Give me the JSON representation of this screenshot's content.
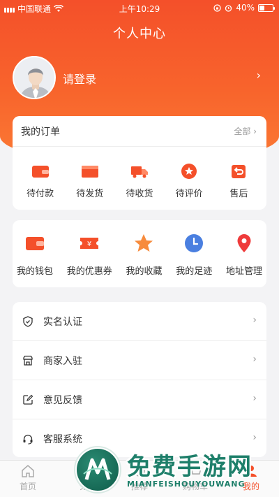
{
  "status_bar": {
    "carrier": "中国联通",
    "time": "上午10:29",
    "battery": "40%"
  },
  "header": {
    "title": "个人中心",
    "login_text": "请登录"
  },
  "orders": {
    "title": "我的订单",
    "all_label": "全部",
    "items": [
      {
        "label": "待付款",
        "icon": "wallet-icon"
      },
      {
        "label": "待发货",
        "icon": "package-icon"
      },
      {
        "label": "待收货",
        "icon": "truck-icon"
      },
      {
        "label": "待评价",
        "icon": "star-badge-icon"
      },
      {
        "label": "售后",
        "icon": "return-icon"
      }
    ]
  },
  "tools": [
    {
      "label": "我的钱包",
      "icon": "wallet-icon"
    },
    {
      "label": "我的优惠券",
      "icon": "coupon-icon"
    },
    {
      "label": "我的收藏",
      "icon": "star-icon"
    },
    {
      "label": "我的足迹",
      "icon": "clock-icon"
    },
    {
      "label": "地址管理",
      "icon": "location-pin-icon"
    }
  ],
  "menu": [
    {
      "label": "实名认证",
      "icon": "shield-check-icon"
    },
    {
      "label": "商家入驻",
      "icon": "store-icon"
    },
    {
      "label": "意见反馈",
      "icon": "edit-icon"
    },
    {
      "label": "客服系统",
      "icon": "headset-icon"
    }
  ],
  "tabbar": {
    "items": [
      {
        "label": "首页",
        "icon": "home-icon"
      },
      {
        "label": "分",
        "icon": "category-icon"
      },
      {
        "label": "推荐",
        "icon": "recommend-icon"
      },
      {
        "label": "购物车",
        "icon": "cart-icon"
      },
      {
        "label": "我的",
        "icon": "user-icon"
      }
    ]
  },
  "watermark": {
    "title": "免费手游网",
    "subtitle": "MIANFEISHOUYOUWANG"
  },
  "colors": {
    "accent": "#f4502a",
    "background": "#f3f3f5",
    "watermark": "#1e7f6a"
  }
}
